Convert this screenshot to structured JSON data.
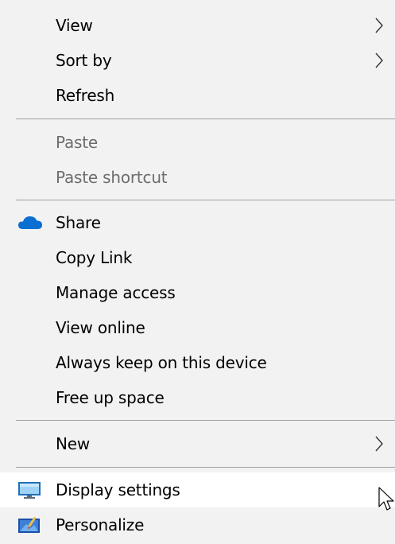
{
  "context_menu": {
    "items": [
      {
        "label": "View",
        "enabled": true,
        "submenu": true
      },
      {
        "label": "Sort by",
        "enabled": true,
        "submenu": true
      },
      {
        "label": "Refresh",
        "enabled": true,
        "submenu": false
      },
      {
        "label": "Paste",
        "enabled": false,
        "submenu": false
      },
      {
        "label": "Paste shortcut",
        "enabled": false,
        "submenu": false
      },
      {
        "label": "Share",
        "enabled": true,
        "submenu": false,
        "icon": "onedrive-cloud-icon"
      },
      {
        "label": "Copy Link",
        "enabled": true,
        "submenu": false
      },
      {
        "label": "Manage access",
        "enabled": true,
        "submenu": false
      },
      {
        "label": "View online",
        "enabled": true,
        "submenu": false
      },
      {
        "label": "Always keep on this device",
        "enabled": true,
        "submenu": false
      },
      {
        "label": "Free up space",
        "enabled": true,
        "submenu": false
      },
      {
        "label": "New",
        "enabled": true,
        "submenu": true
      },
      {
        "label": "Display settings",
        "enabled": true,
        "submenu": false,
        "icon": "display-monitor-icon",
        "hovered": true
      },
      {
        "label": "Personalize",
        "enabled": true,
        "submenu": false,
        "icon": "personalize-icon"
      }
    ]
  },
  "colors": {
    "menu_background": "#f2f2f2",
    "hover_background": "#ffffff",
    "separator": "#a0a0a0",
    "disabled_text": "#6d6d6d",
    "onedrive_blue": "#0a6fd1"
  }
}
